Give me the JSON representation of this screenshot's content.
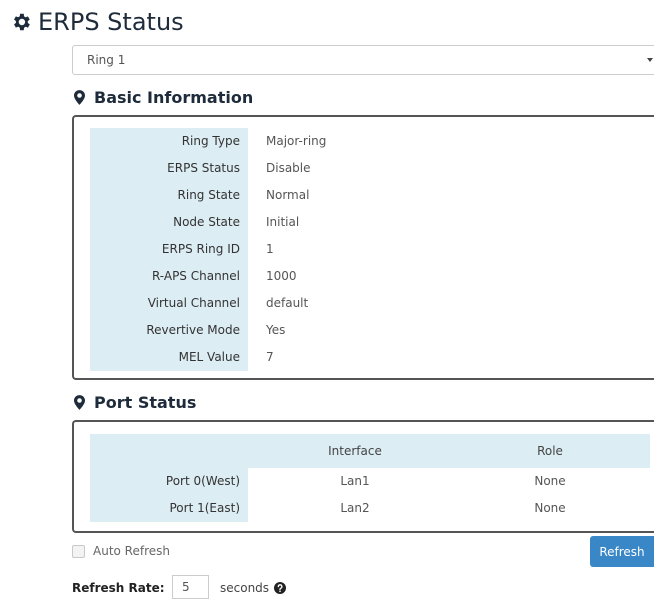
{
  "page": {
    "title": "ERPS Status",
    "icon": "gear-icon"
  },
  "ring_select": {
    "value": "Ring 1"
  },
  "basic_information": {
    "heading": "Basic Information",
    "icon": "map-marker-icon",
    "rows": [
      {
        "label": "Ring Type",
        "value": "Major-ring"
      },
      {
        "label": "ERPS Status",
        "value": "Disable"
      },
      {
        "label": "Ring State",
        "value": "Normal"
      },
      {
        "label": "Node State",
        "value": "Initial"
      },
      {
        "label": "ERPS Ring ID",
        "value": "1"
      },
      {
        "label": "R-APS Channel",
        "value": "1000"
      },
      {
        "label": "Virtual Channel",
        "value": "default"
      },
      {
        "label": "Revertive Mode",
        "value": "Yes"
      },
      {
        "label": "MEL Value",
        "value": "7"
      }
    ]
  },
  "port_status": {
    "heading": "Port Status",
    "icon": "map-marker-icon",
    "columns": [
      "Interface",
      "Role"
    ],
    "rows": [
      {
        "label": "Port 0(West)",
        "interface": "Lan1",
        "role": "None"
      },
      {
        "label": "Port 1(East)",
        "interface": "Lan2",
        "role": "None"
      }
    ]
  },
  "controls": {
    "auto_refresh_label": "Auto Refresh",
    "auto_refresh_checked": false,
    "refresh_button": "Refresh",
    "refresh_rate_label": "Refresh Rate:",
    "refresh_rate_value": "5",
    "refresh_rate_unit": "seconds",
    "help_icon": "question-circle-icon"
  },
  "colors": {
    "accent": "#3a87c8",
    "label_bg": "#dcedf4",
    "heading": "#1e2b3a"
  }
}
